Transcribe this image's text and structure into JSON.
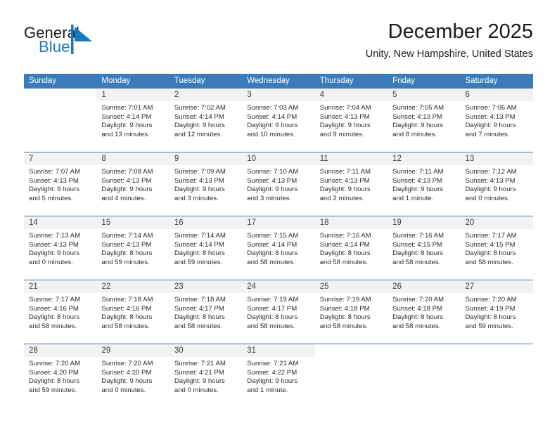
{
  "brand": {
    "name_part1": "General",
    "name_part2": "Blue",
    "flag_icon": "blue-flag-triangle-icon",
    "accent_color": "#1878be"
  },
  "header": {
    "title": "December 2025",
    "subtitle": "Unity, New Hampshire, United States"
  },
  "calendar": {
    "header_bg": "#3a7cba",
    "daynum_band_bg": "#f2f2f2",
    "weekday_headers": [
      "Sunday",
      "Monday",
      "Tuesday",
      "Wednesday",
      "Thursday",
      "Friday",
      "Saturday"
    ],
    "weeks": [
      [
        {
          "day": "",
          "lines": []
        },
        {
          "day": "1",
          "lines": [
            "Sunrise: 7:01 AM",
            "Sunset: 4:14 PM",
            "Daylight: 9 hours",
            "and 13 minutes."
          ]
        },
        {
          "day": "2",
          "lines": [
            "Sunrise: 7:02 AM",
            "Sunset: 4:14 PM",
            "Daylight: 9 hours",
            "and 12 minutes."
          ]
        },
        {
          "day": "3",
          "lines": [
            "Sunrise: 7:03 AM",
            "Sunset: 4:14 PM",
            "Daylight: 9 hours",
            "and 10 minutes."
          ]
        },
        {
          "day": "4",
          "lines": [
            "Sunrise: 7:04 AM",
            "Sunset: 4:13 PM",
            "Daylight: 9 hours",
            "and 9 minutes."
          ]
        },
        {
          "day": "5",
          "lines": [
            "Sunrise: 7:05 AM",
            "Sunset: 4:13 PM",
            "Daylight: 9 hours",
            "and 8 minutes."
          ]
        },
        {
          "day": "6",
          "lines": [
            "Sunrise: 7:06 AM",
            "Sunset: 4:13 PM",
            "Daylight: 9 hours",
            "and 7 minutes."
          ]
        }
      ],
      [
        {
          "day": "7",
          "lines": [
            "Sunrise: 7:07 AM",
            "Sunset: 4:13 PM",
            "Daylight: 9 hours",
            "and 5 minutes."
          ]
        },
        {
          "day": "8",
          "lines": [
            "Sunrise: 7:08 AM",
            "Sunset: 4:13 PM",
            "Daylight: 9 hours",
            "and 4 minutes."
          ]
        },
        {
          "day": "9",
          "lines": [
            "Sunrise: 7:09 AM",
            "Sunset: 4:13 PM",
            "Daylight: 9 hours",
            "and 3 minutes."
          ]
        },
        {
          "day": "10",
          "lines": [
            "Sunrise: 7:10 AM",
            "Sunset: 4:13 PM",
            "Daylight: 9 hours",
            "and 3 minutes."
          ]
        },
        {
          "day": "11",
          "lines": [
            "Sunrise: 7:11 AM",
            "Sunset: 4:13 PM",
            "Daylight: 9 hours",
            "and 2 minutes."
          ]
        },
        {
          "day": "12",
          "lines": [
            "Sunrise: 7:11 AM",
            "Sunset: 4:13 PM",
            "Daylight: 9 hours",
            "and 1 minute."
          ]
        },
        {
          "day": "13",
          "lines": [
            "Sunrise: 7:12 AM",
            "Sunset: 4:13 PM",
            "Daylight: 9 hours",
            "and 0 minutes."
          ]
        }
      ],
      [
        {
          "day": "14",
          "lines": [
            "Sunrise: 7:13 AM",
            "Sunset: 4:13 PM",
            "Daylight: 9 hours",
            "and 0 minutes."
          ]
        },
        {
          "day": "15",
          "lines": [
            "Sunrise: 7:14 AM",
            "Sunset: 4:13 PM",
            "Daylight: 8 hours",
            "and 59 minutes."
          ]
        },
        {
          "day": "16",
          "lines": [
            "Sunrise: 7:14 AM",
            "Sunset: 4:14 PM",
            "Daylight: 8 hours",
            "and 59 minutes."
          ]
        },
        {
          "day": "17",
          "lines": [
            "Sunrise: 7:15 AM",
            "Sunset: 4:14 PM",
            "Daylight: 8 hours",
            "and 58 minutes."
          ]
        },
        {
          "day": "18",
          "lines": [
            "Sunrise: 7:16 AM",
            "Sunset: 4:14 PM",
            "Daylight: 8 hours",
            "and 58 minutes."
          ]
        },
        {
          "day": "19",
          "lines": [
            "Sunrise: 7:16 AM",
            "Sunset: 4:15 PM",
            "Daylight: 8 hours",
            "and 58 minutes."
          ]
        },
        {
          "day": "20",
          "lines": [
            "Sunrise: 7:17 AM",
            "Sunset: 4:15 PM",
            "Daylight: 8 hours",
            "and 58 minutes."
          ]
        }
      ],
      [
        {
          "day": "21",
          "lines": [
            "Sunrise: 7:17 AM",
            "Sunset: 4:16 PM",
            "Daylight: 8 hours",
            "and 58 minutes."
          ]
        },
        {
          "day": "22",
          "lines": [
            "Sunrise: 7:18 AM",
            "Sunset: 4:16 PM",
            "Daylight: 8 hours",
            "and 58 minutes."
          ]
        },
        {
          "day": "23",
          "lines": [
            "Sunrise: 7:18 AM",
            "Sunset: 4:17 PM",
            "Daylight: 8 hours",
            "and 58 minutes."
          ]
        },
        {
          "day": "24",
          "lines": [
            "Sunrise: 7:19 AM",
            "Sunset: 4:17 PM",
            "Daylight: 8 hours",
            "and 58 minutes."
          ]
        },
        {
          "day": "25",
          "lines": [
            "Sunrise: 7:19 AM",
            "Sunset: 4:18 PM",
            "Daylight: 8 hours",
            "and 58 minutes."
          ]
        },
        {
          "day": "26",
          "lines": [
            "Sunrise: 7:20 AM",
            "Sunset: 4:18 PM",
            "Daylight: 8 hours",
            "and 58 minutes."
          ]
        },
        {
          "day": "27",
          "lines": [
            "Sunrise: 7:20 AM",
            "Sunset: 4:19 PM",
            "Daylight: 8 hours",
            "and 59 minutes."
          ]
        }
      ],
      [
        {
          "day": "28",
          "lines": [
            "Sunrise: 7:20 AM",
            "Sunset: 4:20 PM",
            "Daylight: 8 hours",
            "and 59 minutes."
          ]
        },
        {
          "day": "29",
          "lines": [
            "Sunrise: 7:20 AM",
            "Sunset: 4:20 PM",
            "Daylight: 9 hours",
            "and 0 minutes."
          ]
        },
        {
          "day": "30",
          "lines": [
            "Sunrise: 7:21 AM",
            "Sunset: 4:21 PM",
            "Daylight: 9 hours",
            "and 0 minutes."
          ]
        },
        {
          "day": "31",
          "lines": [
            "Sunrise: 7:21 AM",
            "Sunset: 4:22 PM",
            "Daylight: 9 hours",
            "and 1 minute."
          ]
        },
        {
          "day": "",
          "lines": []
        },
        {
          "day": "",
          "lines": []
        },
        {
          "day": "",
          "lines": []
        }
      ]
    ]
  }
}
